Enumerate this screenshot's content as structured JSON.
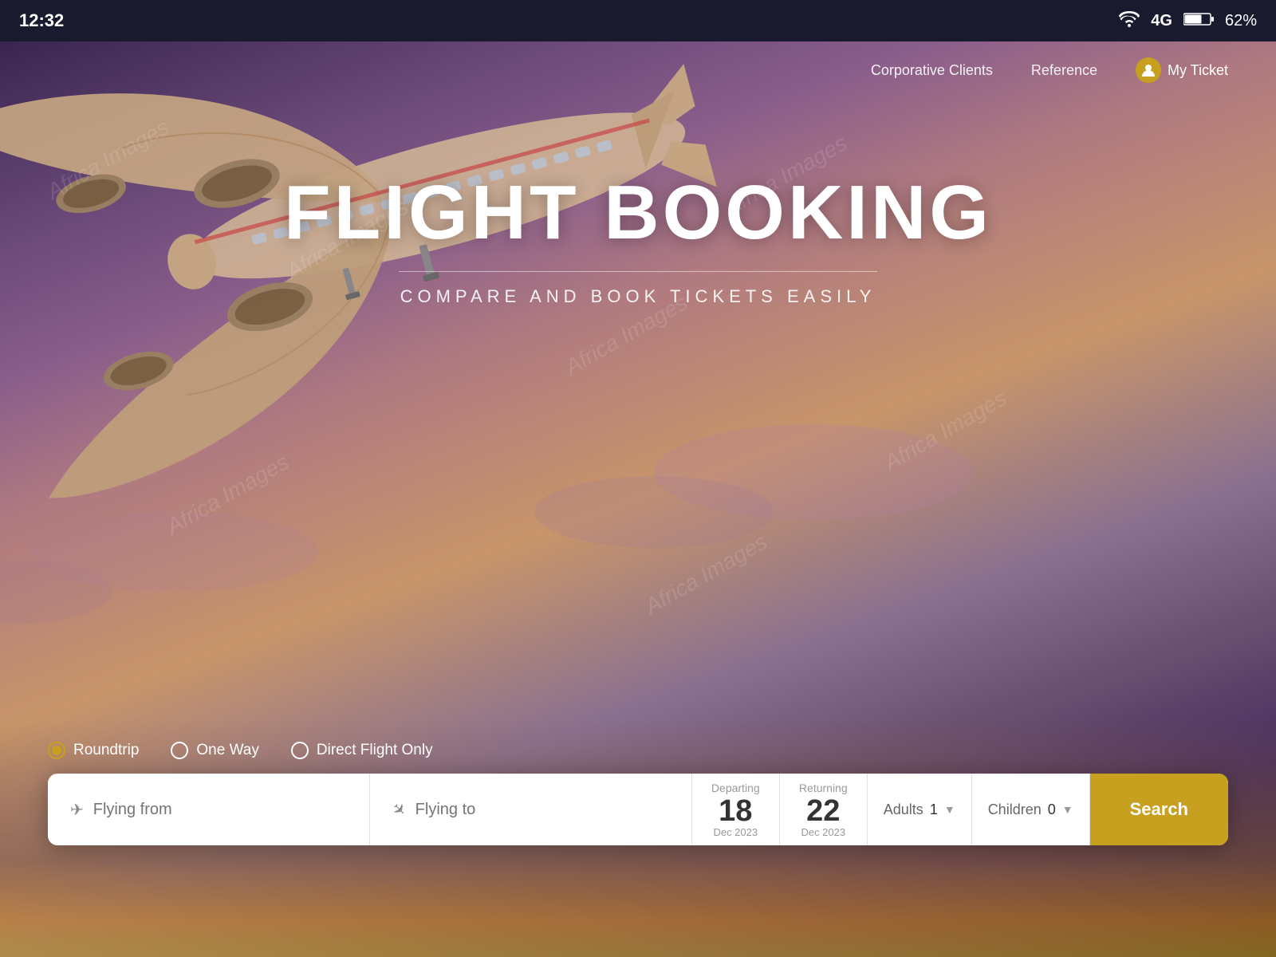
{
  "status": {
    "time": "12:32",
    "network": "4G",
    "battery": "62%"
  },
  "nav": {
    "corporate_clients": "Corporative Clients",
    "reference": "Reference",
    "my_ticket": "My Ticket"
  },
  "hero": {
    "title": "FLIGHT BOOKING",
    "subtitle": "COMPARE AND BOOK TICKETS EASILY"
  },
  "trip_types": {
    "roundtrip": "Roundtrip",
    "one_way": "One Way",
    "direct_only": "Direct Flight Only"
  },
  "search": {
    "flying_from_placeholder": "Flying from",
    "flying_to_placeholder": "Flying to",
    "departing_label": "Departing",
    "departing_day": "18",
    "departing_month": "Dec 2023",
    "returning_label": "Returning",
    "returning_day": "22",
    "returning_month": "Dec 2023",
    "adults_label": "Adults",
    "adults_count": "1",
    "children_label": "Children",
    "children_count": "0",
    "search_button": "Search"
  }
}
